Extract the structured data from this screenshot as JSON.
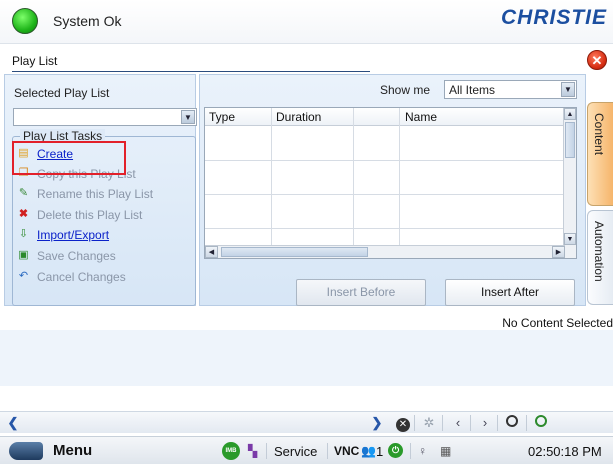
{
  "header": {
    "status_text": "System Ok",
    "logo_text": "CHRISTIE"
  },
  "window": {
    "title": "Play List",
    "close_icon": "close-icon"
  },
  "left_panel": {
    "selected_label": "Selected Play List",
    "selected_value": "",
    "tasks_title": "Play List Tasks",
    "tasks": [
      {
        "label": "Create",
        "icon": "create-icon",
        "enabled": true
      },
      {
        "label": "Copy this Play List",
        "icon": "copy-icon",
        "enabled": false
      },
      {
        "label": "Rename this Play List",
        "icon": "rename-icon",
        "enabled": false
      },
      {
        "label": "Delete this Play List",
        "icon": "delete-icon",
        "enabled": false
      },
      {
        "label": "Import/Export",
        "icon": "import-export-icon",
        "enabled": true
      },
      {
        "label": "Save Changes",
        "icon": "save-icon",
        "enabled": false
      },
      {
        "label": "Cancel Changes",
        "icon": "cancel-icon",
        "enabled": false
      }
    ]
  },
  "content": {
    "show_me_label": "Show me",
    "show_me_value": "All Items",
    "columns": [
      "Type",
      "Duration",
      "",
      "Name"
    ],
    "rows": [],
    "insert_before_label": "Insert Before",
    "insert_after_label": "Insert After",
    "no_content_text": "No Content Selected"
  },
  "side_tabs": [
    "Content",
    "Automation"
  ],
  "statusbar": {
    "menu_label": "Menu",
    "imb_label": "IMB",
    "service_label": "Service",
    "vnc_label": "VNC",
    "user_count": "1",
    "time": "02:50:18 PM"
  },
  "colors": {
    "accent": "#1c4fa0",
    "highlight": "#e2202a",
    "tab_active": "#f6b56b"
  }
}
